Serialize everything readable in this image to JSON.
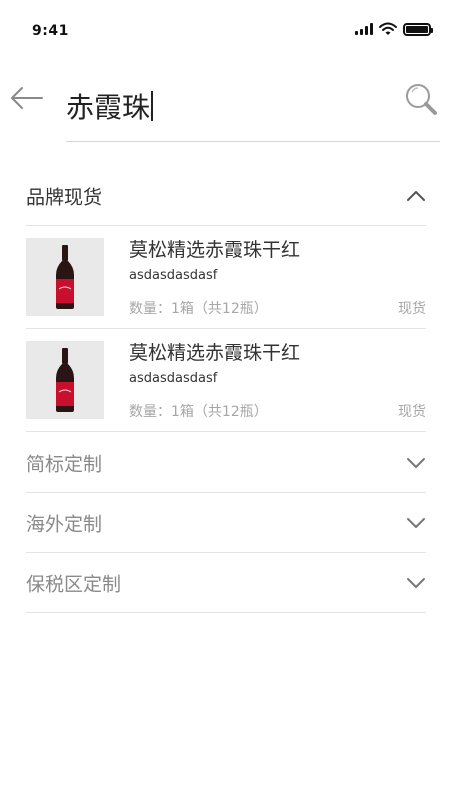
{
  "status_bar": {
    "time": "9:41"
  },
  "search": {
    "query": "赤霞珠"
  },
  "sections": [
    {
      "title": "品牌现货",
      "expanded": true,
      "products": [
        {
          "name": "莫松精选赤霞珠干红",
          "subtitle": "asdasdasdasf",
          "quantity": "数量：1箱（共12瓶）",
          "badge": "现货"
        },
        {
          "name": "莫松精选赤霞珠干红",
          "subtitle": "asdasdasdasf",
          "quantity": "数量：1箱（共12瓶）",
          "badge": "现货"
        }
      ]
    },
    {
      "title": "简标定制",
      "expanded": false
    },
    {
      "title": "海外定制",
      "expanded": false
    },
    {
      "title": "保税区定制",
      "expanded": false
    }
  ],
  "colors": {
    "wine_label": "#c8102e",
    "bottle": "#2a1414",
    "divider": "#e4e4e4"
  },
  "icons": {
    "back": "arrow-left-icon",
    "search": "search-icon",
    "expand": "chevron-down-icon",
    "collapse": "chevron-up-icon"
  }
}
